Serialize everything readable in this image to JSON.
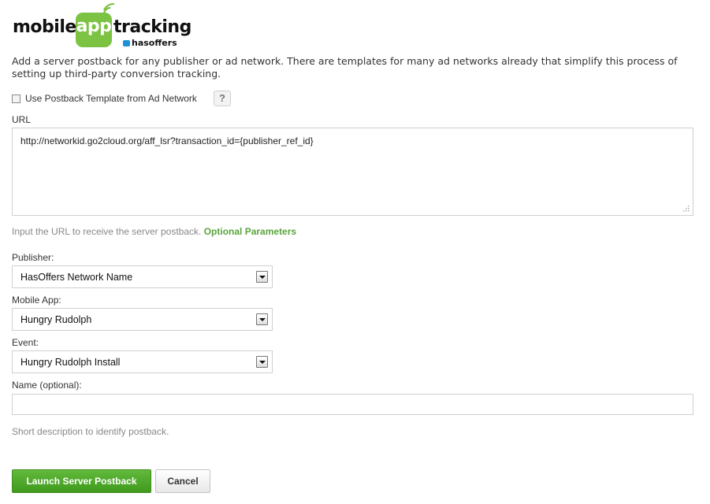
{
  "logo": {
    "word_mobile": "mobile",
    "word_app": "app",
    "word_tracking": "tracking",
    "brand": "hasoffers",
    "brand_color": "#7cc243"
  },
  "intro": "Add a server postback for any publisher or ad network. There are templates for many ad networks already that simplify this process of setting up third-party conversion tracking.",
  "template_checkbox": {
    "label": "Use Postback Template from Ad Network",
    "checked": false,
    "help_label": "?"
  },
  "url_field": {
    "label": "URL",
    "value": "http://networkid.go2cloud.org/aff_lsr?transaction_id={publisher_ref_id}",
    "hint": "Input the URL to receive the server postback.",
    "hint_link": "Optional Parameters"
  },
  "publisher": {
    "label": "Publisher:",
    "value": "HasOffers Network Name"
  },
  "mobile_app": {
    "label": "Mobile App:",
    "value": "Hungry Rudolph"
  },
  "event": {
    "label": "Event:",
    "value": "Hungry Rudolph Install"
  },
  "name_field": {
    "label": "Name (optional):",
    "value": "",
    "hint": "Short description to identify postback."
  },
  "actions": {
    "submit_label": "Launch Server Postback",
    "cancel_label": "Cancel"
  }
}
